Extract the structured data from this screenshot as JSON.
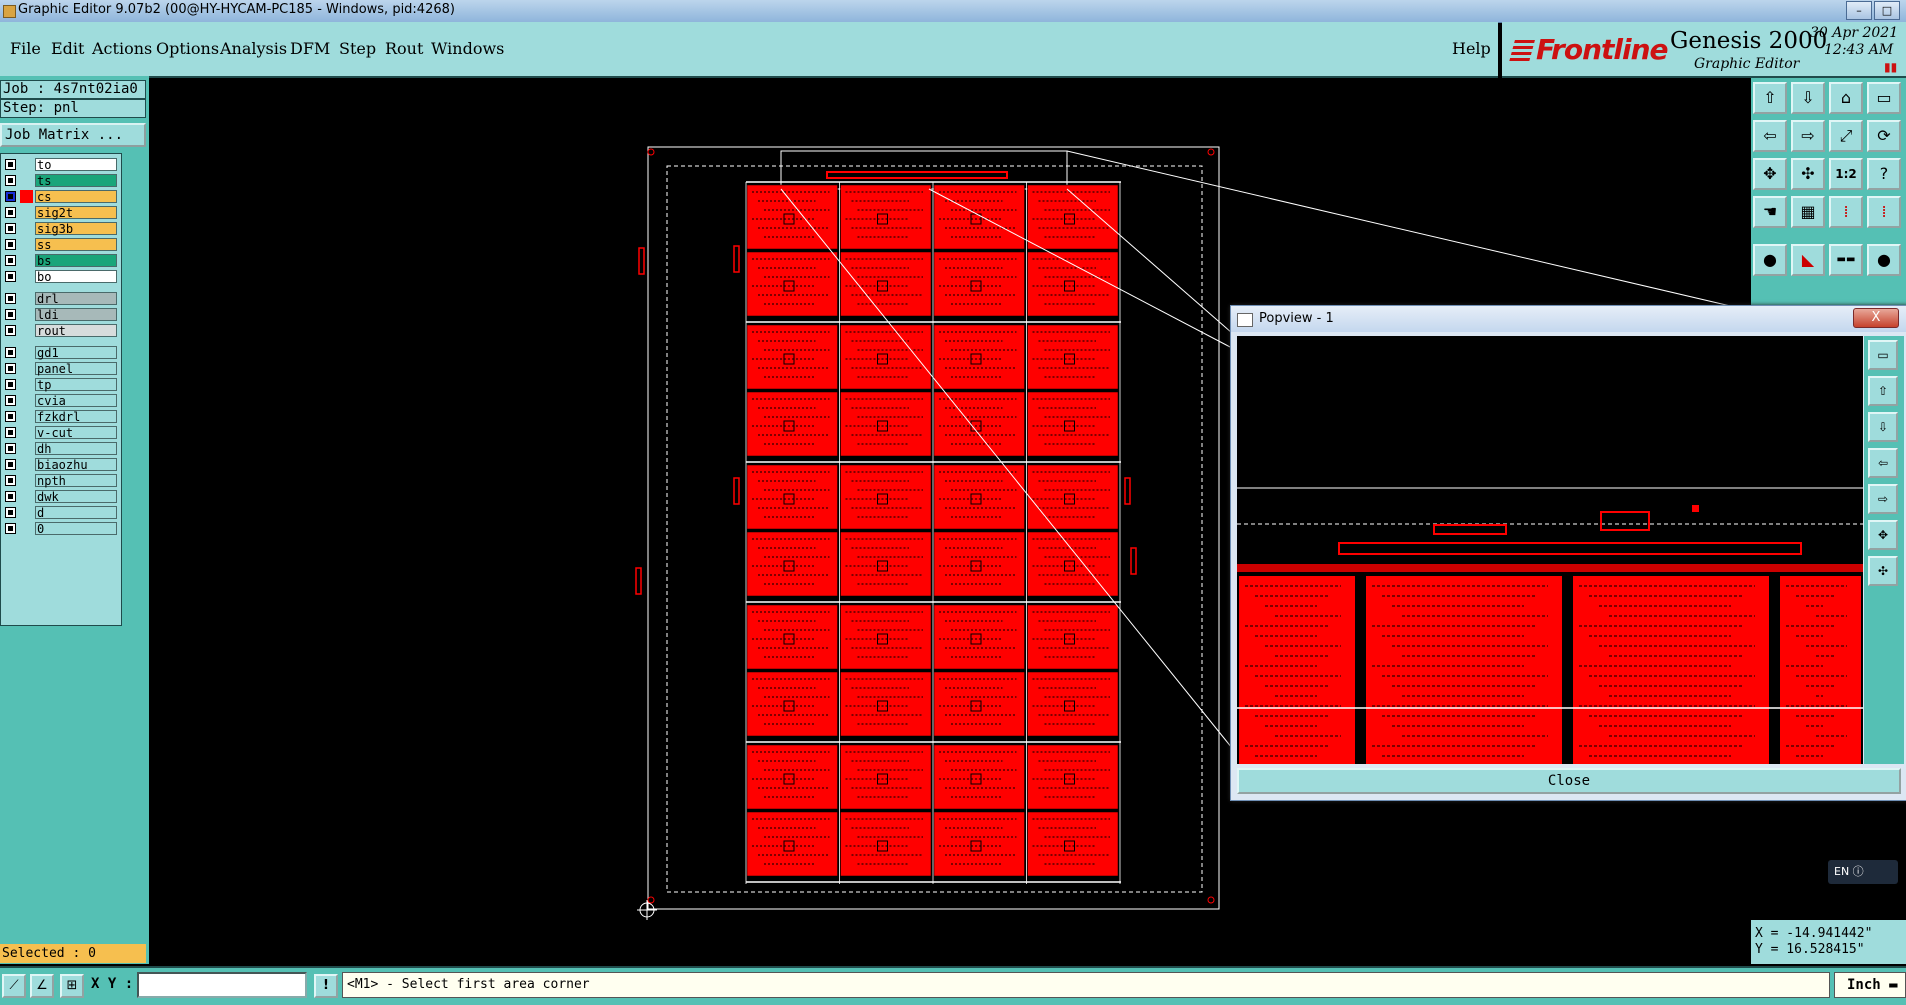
{
  "window": {
    "title": "Graphic Editor 9.07b2 (00@HY-HYCAM-PC185 - Windows, pid:4268)",
    "btn_min": "–",
    "btn_max": "□"
  },
  "menu": {
    "file": "File",
    "edit": "Edit",
    "actions": "Actions",
    "options": "Options",
    "analysis": "Analysis",
    "dfm": "DFM",
    "step": "Step",
    "rout": "Rout",
    "windows": "Windows",
    "help": "Help"
  },
  "brand": {
    "logo": "Frontline",
    "product": "Genesis 2000",
    "subtitle": "Graphic Editor",
    "date": "30 Apr 2021",
    "time": "12:43 AM"
  },
  "job": {
    "job_line": "Job : 4s7nt02ia0",
    "step_line": "Step: pnl",
    "job_matrix": "Job Matrix ..."
  },
  "layers": [
    {
      "name": "to",
      "style": "board",
      "group": 0
    },
    {
      "name": "ts",
      "style": "green",
      "group": 0
    },
    {
      "name": "cs",
      "style": "orange",
      "group": 0,
      "active": true
    },
    {
      "name": "sig2t",
      "style": "orange",
      "group": 0
    },
    {
      "name": "sig3b",
      "style": "orange",
      "group": 0
    },
    {
      "name": "ss",
      "style": "orange",
      "group": 0
    },
    {
      "name": "bs",
      "style": "green",
      "group": 0
    },
    {
      "name": "bo",
      "style": "board",
      "group": 0
    },
    {
      "name": "drl",
      "style": "gray",
      "group": 1
    },
    {
      "name": "ldi",
      "style": "gray",
      "group": 1
    },
    {
      "name": "rout",
      "style": "lightgray",
      "group": 1
    },
    {
      "name": "gd1",
      "style": "teal",
      "group": 2
    },
    {
      "name": "panel",
      "style": "teal",
      "group": 2
    },
    {
      "name": "tp",
      "style": "teal",
      "group": 2
    },
    {
      "name": "cvia",
      "style": "teal",
      "group": 2
    },
    {
      "name": "fzkdrl",
      "style": "teal",
      "group": 2
    },
    {
      "name": "v-cut",
      "style": "teal",
      "group": 2
    },
    {
      "name": "dh",
      "style": "teal",
      "group": 2
    },
    {
      "name": "biaozhu",
      "style": "teal",
      "group": 2
    },
    {
      "name": "npth",
      "style": "teal",
      "group": 2
    },
    {
      "name": "dwk",
      "style": "teal",
      "group": 2
    },
    {
      "name": "d",
      "style": "teal",
      "group": 2
    },
    {
      "name": "0",
      "style": "teal",
      "group": 2
    }
  ],
  "selected": "Selected : 0",
  "coords": {
    "x": "X = -14.941442\"",
    "y": "Y = 16.528415\""
  },
  "bottom": {
    "xy_label": "X Y :",
    "xy_value": "",
    "status": "<M1> - Select first area corner",
    "units": "Inch"
  },
  "popview": {
    "title": "Popview - 1",
    "close_label": "Close",
    "close_x": "X"
  },
  "ime": "EN",
  "colors": {
    "menu_bg": "#9fdcdc",
    "panel_bg": "#55c0b4",
    "copper": "#ff0000",
    "canvas": "#000000"
  }
}
